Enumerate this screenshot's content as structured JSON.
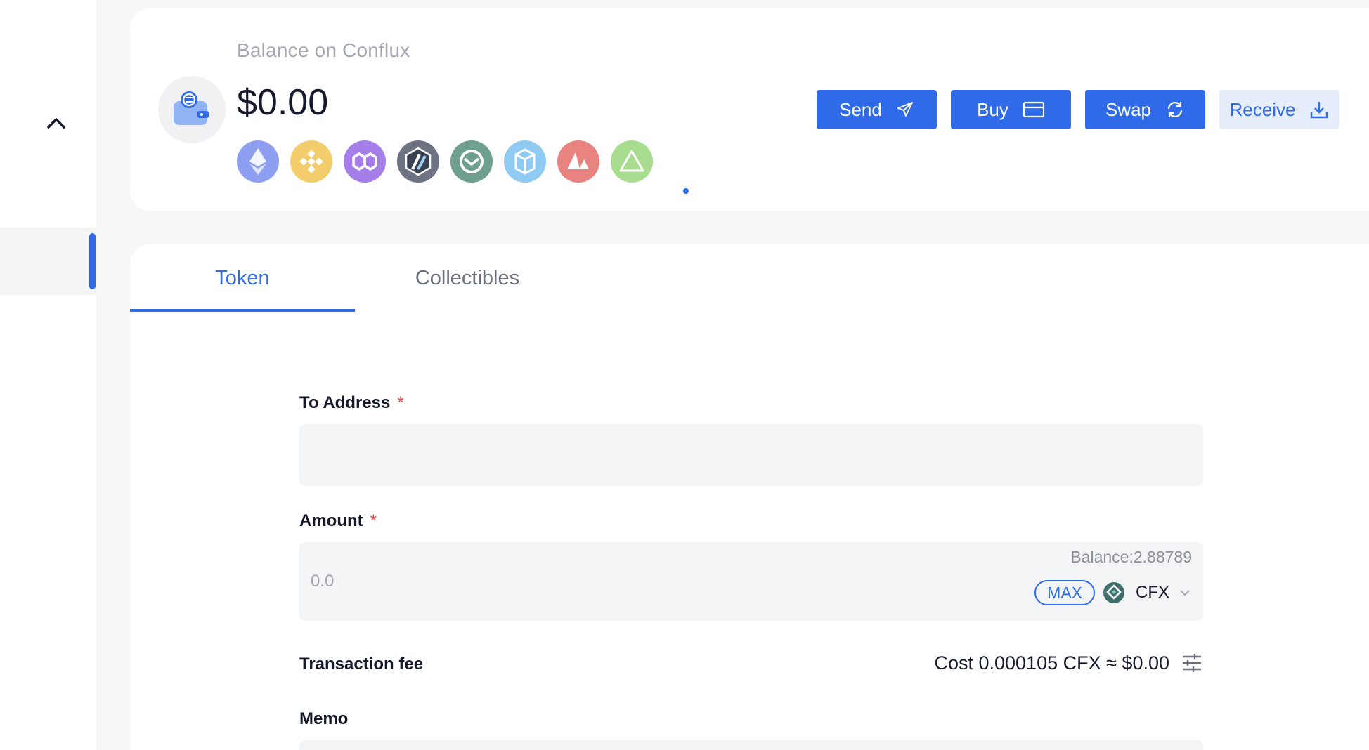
{
  "balance_card": {
    "label": "Balance on Conflux",
    "amount": "$0.00",
    "chains": [
      {
        "name": "ethereum-icon",
        "color": "#8e9ef0"
      },
      {
        "name": "bnb-icon",
        "color": "#f3cd6b"
      },
      {
        "name": "polygon-icon",
        "color": "#a57ee9"
      },
      {
        "name": "arbitrum-icon",
        "color": "#6e7384"
      },
      {
        "name": "gnosis-icon",
        "color": "#6f9f8e"
      },
      {
        "name": "fantom-icon",
        "color": "#8fcaf2"
      },
      {
        "name": "avalanche-icon",
        "color": "#e8837f"
      },
      {
        "name": "neon-icon",
        "color": "#a8dc8f"
      }
    ]
  },
  "actions": {
    "send": "Send",
    "buy": "Buy",
    "swap": "Swap",
    "receive": "Receive"
  },
  "tabs": {
    "token": "Token",
    "collectibles": "Collectibles"
  },
  "form": {
    "to_address_label": "To Address",
    "required_mark": "*",
    "to_address_value": "",
    "amount_label": "Amount",
    "amount_placeholder": "0.0",
    "balance_text": "Balance:2.88789",
    "max_label": "MAX",
    "token_symbol": "CFX",
    "fee_label": "Transaction fee",
    "fee_value": "Cost 0.000105 CFX ≈ $0.00",
    "memo_label": "Memo"
  },
  "colors": {
    "accent": "#2f6ae8",
    "required": "#e5484d"
  }
}
